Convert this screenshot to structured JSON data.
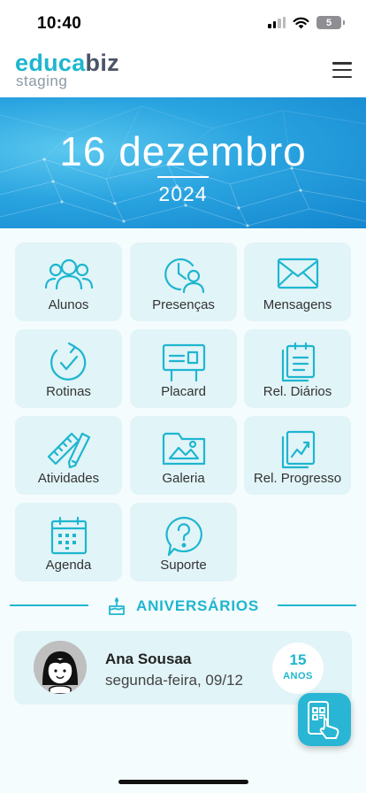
{
  "status_bar": {
    "time": "10:40",
    "battery": "5"
  },
  "header": {
    "logo_part1": "educa",
    "logo_part2": "biz",
    "subtitle": "staging"
  },
  "banner": {
    "date": "16 dezembro",
    "year": "2024"
  },
  "menu": [
    {
      "label": "Alunos",
      "icon": "people-icon"
    },
    {
      "label": "Presenças",
      "icon": "clock-person-icon"
    },
    {
      "label": "Mensagens",
      "icon": "envelope-icon"
    },
    {
      "label": "Rotinas",
      "icon": "refresh-check-icon"
    },
    {
      "label": "Placard",
      "icon": "board-icon"
    },
    {
      "label": "Rel. Diários",
      "icon": "clipboard-icon"
    },
    {
      "label": "Atividades",
      "icon": "ruler-pencil-icon"
    },
    {
      "label": "Galeria",
      "icon": "image-folder-icon"
    },
    {
      "label": "Rel. Progresso",
      "icon": "chart-report-icon"
    },
    {
      "label": "Agenda",
      "icon": "calendar-icon"
    },
    {
      "label": "Suporte",
      "icon": "question-bubble-icon"
    }
  ],
  "birthdays": {
    "title": "ANIVERSÁRIOS",
    "items": [
      {
        "name": "Ana Sousaa",
        "date": "segunda-feira, 09/12",
        "age": "15",
        "age_unit": "ANOS"
      }
    ]
  },
  "colors": {
    "accent": "#1eb6cf",
    "tile_bg": "#e1f4f8",
    "banner": "#2aa4e0"
  }
}
